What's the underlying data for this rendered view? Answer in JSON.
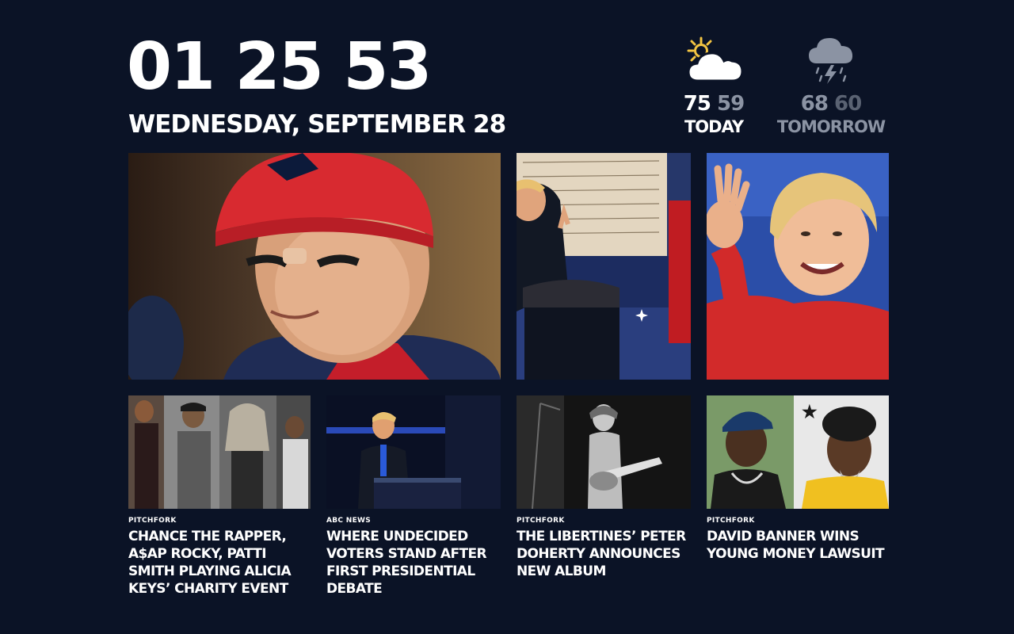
{
  "clock": {
    "time": "01 25 53",
    "date": "WEDNESDAY, SEPTEMBER 28"
  },
  "weather": {
    "today": {
      "icon": "partly-cloudy-icon",
      "high": "75",
      "low": "59",
      "label": "TODAY"
    },
    "tomorrow": {
      "icon": "thunderstorm-icon",
      "high": "68",
      "low": "60",
      "label": "TOMORROW"
    }
  },
  "featured": [
    {
      "name": "football-player-photo",
      "icon": "photo"
    },
    {
      "name": "presidential-debate-photo",
      "icon": "photo"
    },
    {
      "name": "candidate-waving-photo",
      "icon": "photo"
    }
  ],
  "stories": [
    {
      "source": "PITCHFORK",
      "headline": "CHANCE THE RAPPER, A$AP ROCKY, PATTI SMITH PLAYING ALICIA KEYS’ CHARITY EVENT"
    },
    {
      "source": "ABC NEWS",
      "headline": "WHERE UNDECIDED VOTERS STAND AFTER FIRST PRESIDENTIAL DEBATE"
    },
    {
      "source": "PITCHFORK",
      "headline": "THE LIBERTINES’ PETER DOHERTY ANNOUNCES NEW ALBUM"
    },
    {
      "source": "PITCHFORK",
      "headline": "DAVID BANNER WINS YOUNG MONEY LAWSUIT"
    }
  ],
  "colors": {
    "background": "#0b1326",
    "text": "#ffffff",
    "muted": "#8b93a3",
    "dim": "#5a6272",
    "sun": "#f4c542"
  }
}
